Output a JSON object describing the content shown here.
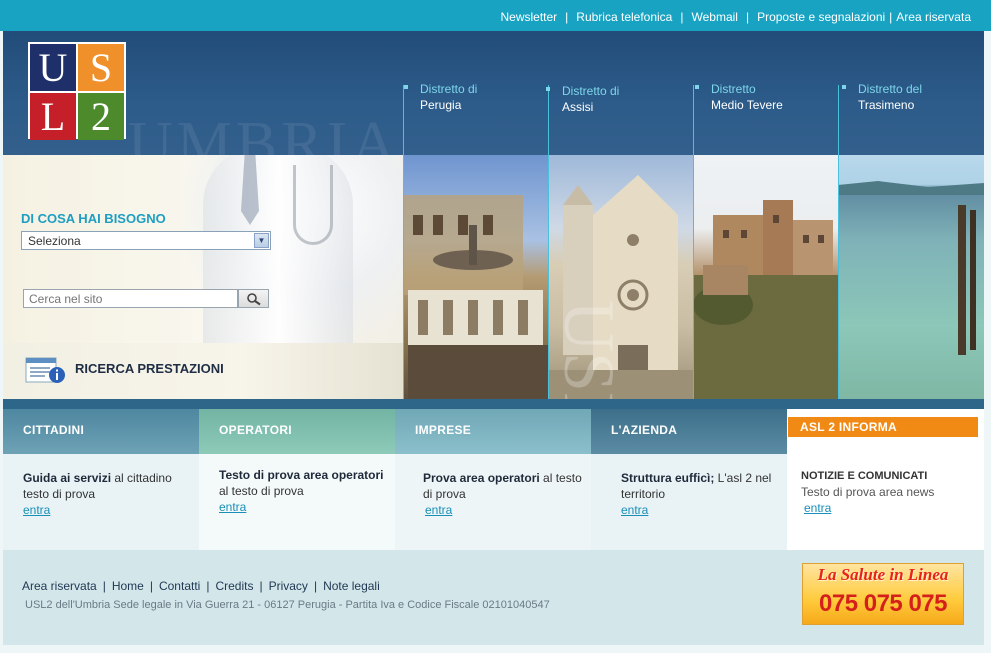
{
  "topnav": {
    "items": [
      "Newsletter",
      "Rubrica telefonica",
      "Webmail",
      "Proposte e segnalazioni",
      "Area riservata"
    ]
  },
  "header": {
    "logo_letters": [
      "U",
      "S",
      "L",
      "2"
    ],
    "watermark": "UMBRIA",
    "districts": [
      {
        "line1": "Distretto di",
        "line2": "Perugia"
      },
      {
        "line1": "Distretto di",
        "line2": "Assisi"
      },
      {
        "line1": "Distretto",
        "line2": "Medio Tevere"
      },
      {
        "line1": "Distretto del",
        "line2": "Trasimeno"
      }
    ]
  },
  "finder": {
    "label": "DI COSA HAI BISOGNO",
    "select_value": "Seleziona",
    "search_placeholder": "Cerca nel sito"
  },
  "ricerca": {
    "label": "RICERCA PRESTAZIONI"
  },
  "photo_watermark": "USL 2",
  "tabs": [
    "CITTADINI",
    "OPERATORI",
    "IMPRESE",
    "L'AZIENDA",
    "ASL 2 INFORMA"
  ],
  "columns": [
    {
      "bold": "Guida ai servizi",
      "text": " al cittadino testo di prova",
      "link": "entra"
    },
    {
      "bold": "Testo di prova area operatori",
      "text": " al testo di prova",
      "link": "entra"
    },
    {
      "bold": "Prova area operatori",
      "text": " al testo di prova",
      "link": "entra"
    },
    {
      "bold": "Struttura eufficì;",
      "text": " L'asl 2 nel territorio",
      "link": "entra"
    },
    {
      "bold": "NOTIZIE E COMUNICATI",
      "text": "Testo di prova area news",
      "link": "entra"
    }
  ],
  "footer": {
    "links": [
      "Area riservata",
      "Home",
      "Contatti",
      "Credits",
      "Privacy",
      "Note legali"
    ],
    "address": "USL2 dell'Umbria Sede legale in Via Guerra 21 - 06127 Perugia - Partita Iva e Codice Fiscale 02101040547"
  },
  "banner": {
    "title": "La Salute in Linea",
    "number": "075 075 075"
  },
  "colors": {
    "topbar": "#18a3c3",
    "header": "#2d5c8a",
    "accent_orange": "#f08a14",
    "link": "#1a8fb8"
  }
}
